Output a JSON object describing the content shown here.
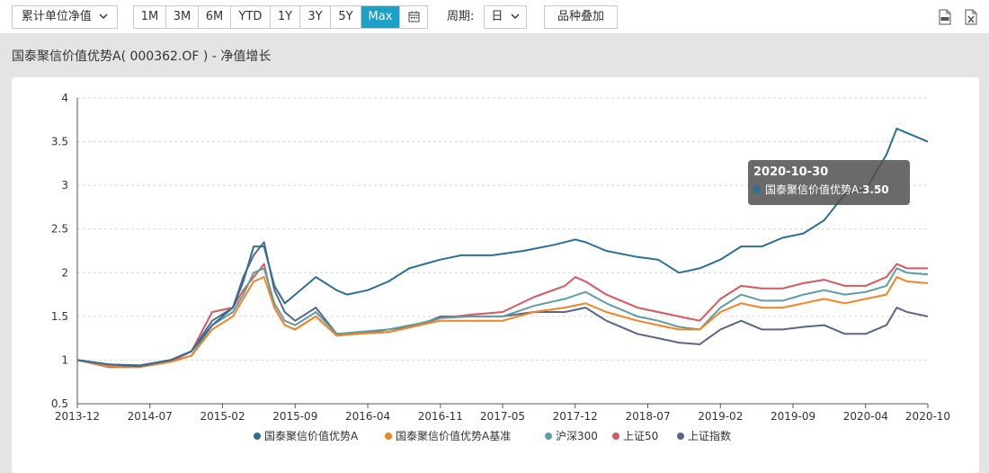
{
  "toolbar": {
    "measure_select": "累计单位净值",
    "ranges": [
      {
        "label": "1M",
        "active": false
      },
      {
        "label": "3M",
        "active": false
      },
      {
        "label": "6M",
        "active": false
      },
      {
        "label": "YTD",
        "active": false
      },
      {
        "label": "1Y",
        "active": false
      },
      {
        "label": "3Y",
        "active": false
      },
      {
        "label": "5Y",
        "active": false
      },
      {
        "label": "Max",
        "active": true
      }
    ],
    "period_label": "周期:",
    "period_value": "日",
    "overlay_button": "品种叠加",
    "pdf_icon": "pdf-file-icon",
    "excel_icon": "excel-file-icon"
  },
  "chart_title": "国泰聚信价值优势A( 000362.OF ) - 净值增长",
  "tooltip": {
    "date": "2020-10-30",
    "series": "国泰聚信价值优势A",
    "value": "3.50",
    "color": "#2a7096"
  },
  "chart_data": {
    "type": "line",
    "ylim": [
      0.5,
      4
    ],
    "yticks": [
      "0.5",
      "1",
      "1.5",
      "2",
      "2.5",
      "3",
      "3.5",
      "4"
    ],
    "xlim": [
      "2013-12",
      "2020-10"
    ],
    "xticks": [
      "2013-12",
      "2014-07",
      "2015-02",
      "2015-09",
      "2016-04",
      "2016-11",
      "2017-05",
      "2017-12",
      "2018-07",
      "2019-02",
      "2019-09",
      "2020-04",
      "2020-10"
    ],
    "grid": true,
    "legend_position": "bottom",
    "series": [
      {
        "name": "国泰聚信价值优势A",
        "color": "#2a7096",
        "points": [
          [
            "2013-12",
            1.0
          ],
          [
            "2014-03",
            0.95
          ],
          [
            "2014-06",
            0.93
          ],
          [
            "2014-09",
            1.0
          ],
          [
            "2014-11",
            1.1
          ],
          [
            "2015-01",
            1.4
          ],
          [
            "2015-03",
            1.6
          ],
          [
            "2015-04",
            1.9
          ],
          [
            "2015-05",
            2.3
          ],
          [
            "2015-06",
            2.3
          ],
          [
            "2015-07",
            1.85
          ],
          [
            "2015-08",
            1.65
          ],
          [
            "2015-09",
            1.75
          ],
          [
            "2015-10",
            1.85
          ],
          [
            "2015-11",
            1.95
          ],
          [
            "2016-01",
            1.8
          ],
          [
            "2016-02",
            1.75
          ],
          [
            "2016-04",
            1.8
          ],
          [
            "2016-06",
            1.9
          ],
          [
            "2016-08",
            2.05
          ],
          [
            "2016-11",
            2.15
          ],
          [
            "2017-01",
            2.2
          ],
          [
            "2017-04",
            2.2
          ],
          [
            "2017-07",
            2.25
          ],
          [
            "2017-10",
            2.32
          ],
          [
            "2017-12",
            2.38
          ],
          [
            "2018-01",
            2.35
          ],
          [
            "2018-03",
            2.25
          ],
          [
            "2018-06",
            2.18
          ],
          [
            "2018-08",
            2.15
          ],
          [
            "2018-10",
            2.0
          ],
          [
            "2018-12",
            2.05
          ],
          [
            "2019-02",
            2.15
          ],
          [
            "2019-04",
            2.3
          ],
          [
            "2019-06",
            2.3
          ],
          [
            "2019-08",
            2.4
          ],
          [
            "2019-10",
            2.45
          ],
          [
            "2019-12",
            2.6
          ],
          [
            "2020-02",
            2.9
          ],
          [
            "2020-04",
            2.95
          ],
          [
            "2020-06",
            3.35
          ],
          [
            "2020-07",
            3.65
          ],
          [
            "2020-08",
            3.6
          ],
          [
            "2020-09",
            3.55
          ],
          [
            "2020-10",
            3.5
          ]
        ]
      },
      {
        "name": "国泰聚信价值优势A基准",
        "color": "#f5831f",
        "points": [
          [
            "2013-12",
            1.0
          ],
          [
            "2014-03",
            0.93
          ],
          [
            "2014-06",
            0.92
          ],
          [
            "2014-09",
            0.98
          ],
          [
            "2014-11",
            1.05
          ],
          [
            "2015-01",
            1.35
          ],
          [
            "2015-03",
            1.5
          ],
          [
            "2015-04",
            1.7
          ],
          [
            "2015-05",
            1.9
          ],
          [
            "2015-06",
            1.95
          ],
          [
            "2015-07",
            1.6
          ],
          [
            "2015-08",
            1.4
          ],
          [
            "2015-09",
            1.35
          ],
          [
            "2015-11",
            1.5
          ],
          [
            "2016-01",
            1.28
          ],
          [
            "2016-03",
            1.3
          ],
          [
            "2016-06",
            1.32
          ],
          [
            "2016-09",
            1.4
          ],
          [
            "2016-11",
            1.45
          ],
          [
            "2017-02",
            1.45
          ],
          [
            "2017-05",
            1.45
          ],
          [
            "2017-08",
            1.55
          ],
          [
            "2017-11",
            1.6
          ],
          [
            "2018-01",
            1.65
          ],
          [
            "2018-03",
            1.55
          ],
          [
            "2018-06",
            1.45
          ],
          [
            "2018-08",
            1.4
          ],
          [
            "2018-10",
            1.35
          ],
          [
            "2018-12",
            1.35
          ],
          [
            "2019-02",
            1.55
          ],
          [
            "2019-04",
            1.65
          ],
          [
            "2019-06",
            1.6
          ],
          [
            "2019-08",
            1.6
          ],
          [
            "2019-10",
            1.65
          ],
          [
            "2019-12",
            1.7
          ],
          [
            "2020-02",
            1.65
          ],
          [
            "2020-04",
            1.7
          ],
          [
            "2020-06",
            1.75
          ],
          [
            "2020-07",
            1.95
          ],
          [
            "2020-08",
            1.9
          ],
          [
            "2020-10",
            1.88
          ]
        ]
      },
      {
        "name": "沪深300",
        "color": "#5b9ea3",
        "points": [
          [
            "2013-12",
            1.0
          ],
          [
            "2014-03",
            0.93
          ],
          [
            "2014-06",
            0.93
          ],
          [
            "2014-09",
            0.98
          ],
          [
            "2014-11",
            1.05
          ],
          [
            "2015-01",
            1.4
          ],
          [
            "2015-03",
            1.55
          ],
          [
            "2015-04",
            1.75
          ],
          [
            "2015-05",
            2.0
          ],
          [
            "2015-06",
            2.05
          ],
          [
            "2015-07",
            1.65
          ],
          [
            "2015-08",
            1.45
          ],
          [
            "2015-09",
            1.4
          ],
          [
            "2015-11",
            1.55
          ],
          [
            "2016-01",
            1.3
          ],
          [
            "2016-03",
            1.32
          ],
          [
            "2016-06",
            1.35
          ],
          [
            "2016-09",
            1.42
          ],
          [
            "2016-11",
            1.48
          ],
          [
            "2017-02",
            1.5
          ],
          [
            "2017-05",
            1.5
          ],
          [
            "2017-08",
            1.62
          ],
          [
            "2017-11",
            1.7
          ],
          [
            "2018-01",
            1.78
          ],
          [
            "2018-03",
            1.65
          ],
          [
            "2018-06",
            1.5
          ],
          [
            "2018-08",
            1.45
          ],
          [
            "2018-10",
            1.38
          ],
          [
            "2018-12",
            1.35
          ],
          [
            "2019-02",
            1.6
          ],
          [
            "2019-04",
            1.75
          ],
          [
            "2019-06",
            1.68
          ],
          [
            "2019-08",
            1.68
          ],
          [
            "2019-10",
            1.75
          ],
          [
            "2019-12",
            1.8
          ],
          [
            "2020-02",
            1.75
          ],
          [
            "2020-04",
            1.78
          ],
          [
            "2020-06",
            1.85
          ],
          [
            "2020-07",
            2.05
          ],
          [
            "2020-08",
            2.0
          ],
          [
            "2020-10",
            1.98
          ]
        ]
      },
      {
        "name": "上证50",
        "color": "#d9575f",
        "points": [
          [
            "2013-12",
            1.0
          ],
          [
            "2014-03",
            0.92
          ],
          [
            "2014-06",
            0.92
          ],
          [
            "2014-09",
            0.98
          ],
          [
            "2014-11",
            1.1
          ],
          [
            "2015-01",
            1.55
          ],
          [
            "2015-03",
            1.6
          ],
          [
            "2015-04",
            1.8
          ],
          [
            "2015-05",
            1.95
          ],
          [
            "2015-06",
            2.1
          ],
          [
            "2015-07",
            1.6
          ],
          [
            "2015-08",
            1.4
          ],
          [
            "2015-09",
            1.35
          ],
          [
            "2015-11",
            1.5
          ],
          [
            "2016-01",
            1.28
          ],
          [
            "2016-03",
            1.3
          ],
          [
            "2016-06",
            1.32
          ],
          [
            "2016-09",
            1.4
          ],
          [
            "2016-11",
            1.48
          ],
          [
            "2017-02",
            1.52
          ],
          [
            "2017-05",
            1.55
          ],
          [
            "2017-08",
            1.72
          ],
          [
            "2017-11",
            1.85
          ],
          [
            "2017-12",
            1.95
          ],
          [
            "2018-01",
            1.9
          ],
          [
            "2018-03",
            1.75
          ],
          [
            "2018-06",
            1.6
          ],
          [
            "2018-08",
            1.55
          ],
          [
            "2018-10",
            1.5
          ],
          [
            "2018-12",
            1.45
          ],
          [
            "2019-02",
            1.7
          ],
          [
            "2019-04",
            1.85
          ],
          [
            "2019-06",
            1.82
          ],
          [
            "2019-08",
            1.82
          ],
          [
            "2019-10",
            1.88
          ],
          [
            "2019-12",
            1.92
          ],
          [
            "2020-02",
            1.85
          ],
          [
            "2020-04",
            1.85
          ],
          [
            "2020-06",
            1.95
          ],
          [
            "2020-07",
            2.1
          ],
          [
            "2020-08",
            2.05
          ],
          [
            "2020-10",
            2.05
          ]
        ]
      },
      {
        "name": "上证指数",
        "color": "#5a6688",
        "points": [
          [
            "2013-12",
            1.0
          ],
          [
            "2014-03",
            0.95
          ],
          [
            "2014-06",
            0.94
          ],
          [
            "2014-09",
            1.0
          ],
          [
            "2014-11",
            1.1
          ],
          [
            "2015-01",
            1.45
          ],
          [
            "2015-03",
            1.6
          ],
          [
            "2015-04",
            1.95
          ],
          [
            "2015-05",
            2.2
          ],
          [
            "2015-06",
            2.35
          ],
          [
            "2015-07",
            1.8
          ],
          [
            "2015-08",
            1.55
          ],
          [
            "2015-09",
            1.45
          ],
          [
            "2015-11",
            1.6
          ],
          [
            "2016-01",
            1.3
          ],
          [
            "2016-03",
            1.3
          ],
          [
            "2016-06",
            1.35
          ],
          [
            "2016-09",
            1.4
          ],
          [
            "2016-11",
            1.5
          ],
          [
            "2017-02",
            1.5
          ],
          [
            "2017-05",
            1.5
          ],
          [
            "2017-08",
            1.55
          ],
          [
            "2017-11",
            1.55
          ],
          [
            "2018-01",
            1.6
          ],
          [
            "2018-03",
            1.45
          ],
          [
            "2018-06",
            1.3
          ],
          [
            "2018-08",
            1.25
          ],
          [
            "2018-10",
            1.2
          ],
          [
            "2018-12",
            1.18
          ],
          [
            "2019-02",
            1.35
          ],
          [
            "2019-04",
            1.45
          ],
          [
            "2019-06",
            1.35
          ],
          [
            "2019-08",
            1.35
          ],
          [
            "2019-10",
            1.38
          ],
          [
            "2019-12",
            1.4
          ],
          [
            "2020-02",
            1.3
          ],
          [
            "2020-04",
            1.3
          ],
          [
            "2020-06",
            1.4
          ],
          [
            "2020-07",
            1.6
          ],
          [
            "2020-08",
            1.55
          ],
          [
            "2020-10",
            1.5
          ]
        ]
      }
    ]
  }
}
